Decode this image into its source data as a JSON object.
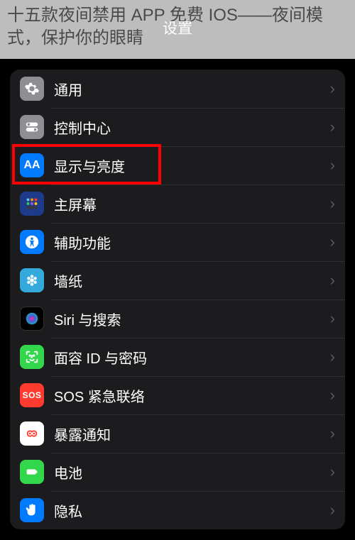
{
  "article": {
    "headline": "十五款夜间禁用 APP 免费 IOS——夜间模式，保护你的眼睛"
  },
  "header": {
    "title": "设置"
  },
  "highlight_accent": "#ff0000",
  "settings_items": [
    {
      "id": "general",
      "label": "通用",
      "icon": "gear",
      "icon_bg": "bg-gray"
    },
    {
      "id": "control-center",
      "label": "控制中心",
      "icon": "toggles",
      "icon_bg": "bg-gray"
    },
    {
      "id": "display",
      "label": "显示与亮度",
      "icon": "aa",
      "icon_bg": "bg-blue",
      "highlighted": true
    },
    {
      "id": "home-screen",
      "label": "主屏幕",
      "icon": "grid",
      "icon_bg": "bg-darkblue"
    },
    {
      "id": "accessibility",
      "label": "辅助功能",
      "icon": "person-circle",
      "icon_bg": "bg-blue"
    },
    {
      "id": "wallpaper",
      "label": "墙纸",
      "icon": "flower",
      "icon_bg": "bg-cyan"
    },
    {
      "id": "siri",
      "label": "Siri 与搜索",
      "icon": "siri",
      "icon_bg": "bg-black"
    },
    {
      "id": "faceid",
      "label": "面容 ID 与密码",
      "icon": "face",
      "icon_bg": "bg-green"
    },
    {
      "id": "sos",
      "label": "SOS 紧急联络",
      "icon": "sos",
      "icon_bg": "bg-red"
    },
    {
      "id": "exposure",
      "label": "暴露通知",
      "icon": "exposure",
      "icon_bg": "bg-white"
    },
    {
      "id": "battery",
      "label": "电池",
      "icon": "battery",
      "icon_bg": "bg-green"
    },
    {
      "id": "privacy",
      "label": "隐私",
      "icon": "hand",
      "icon_bg": "bg-blue"
    }
  ]
}
